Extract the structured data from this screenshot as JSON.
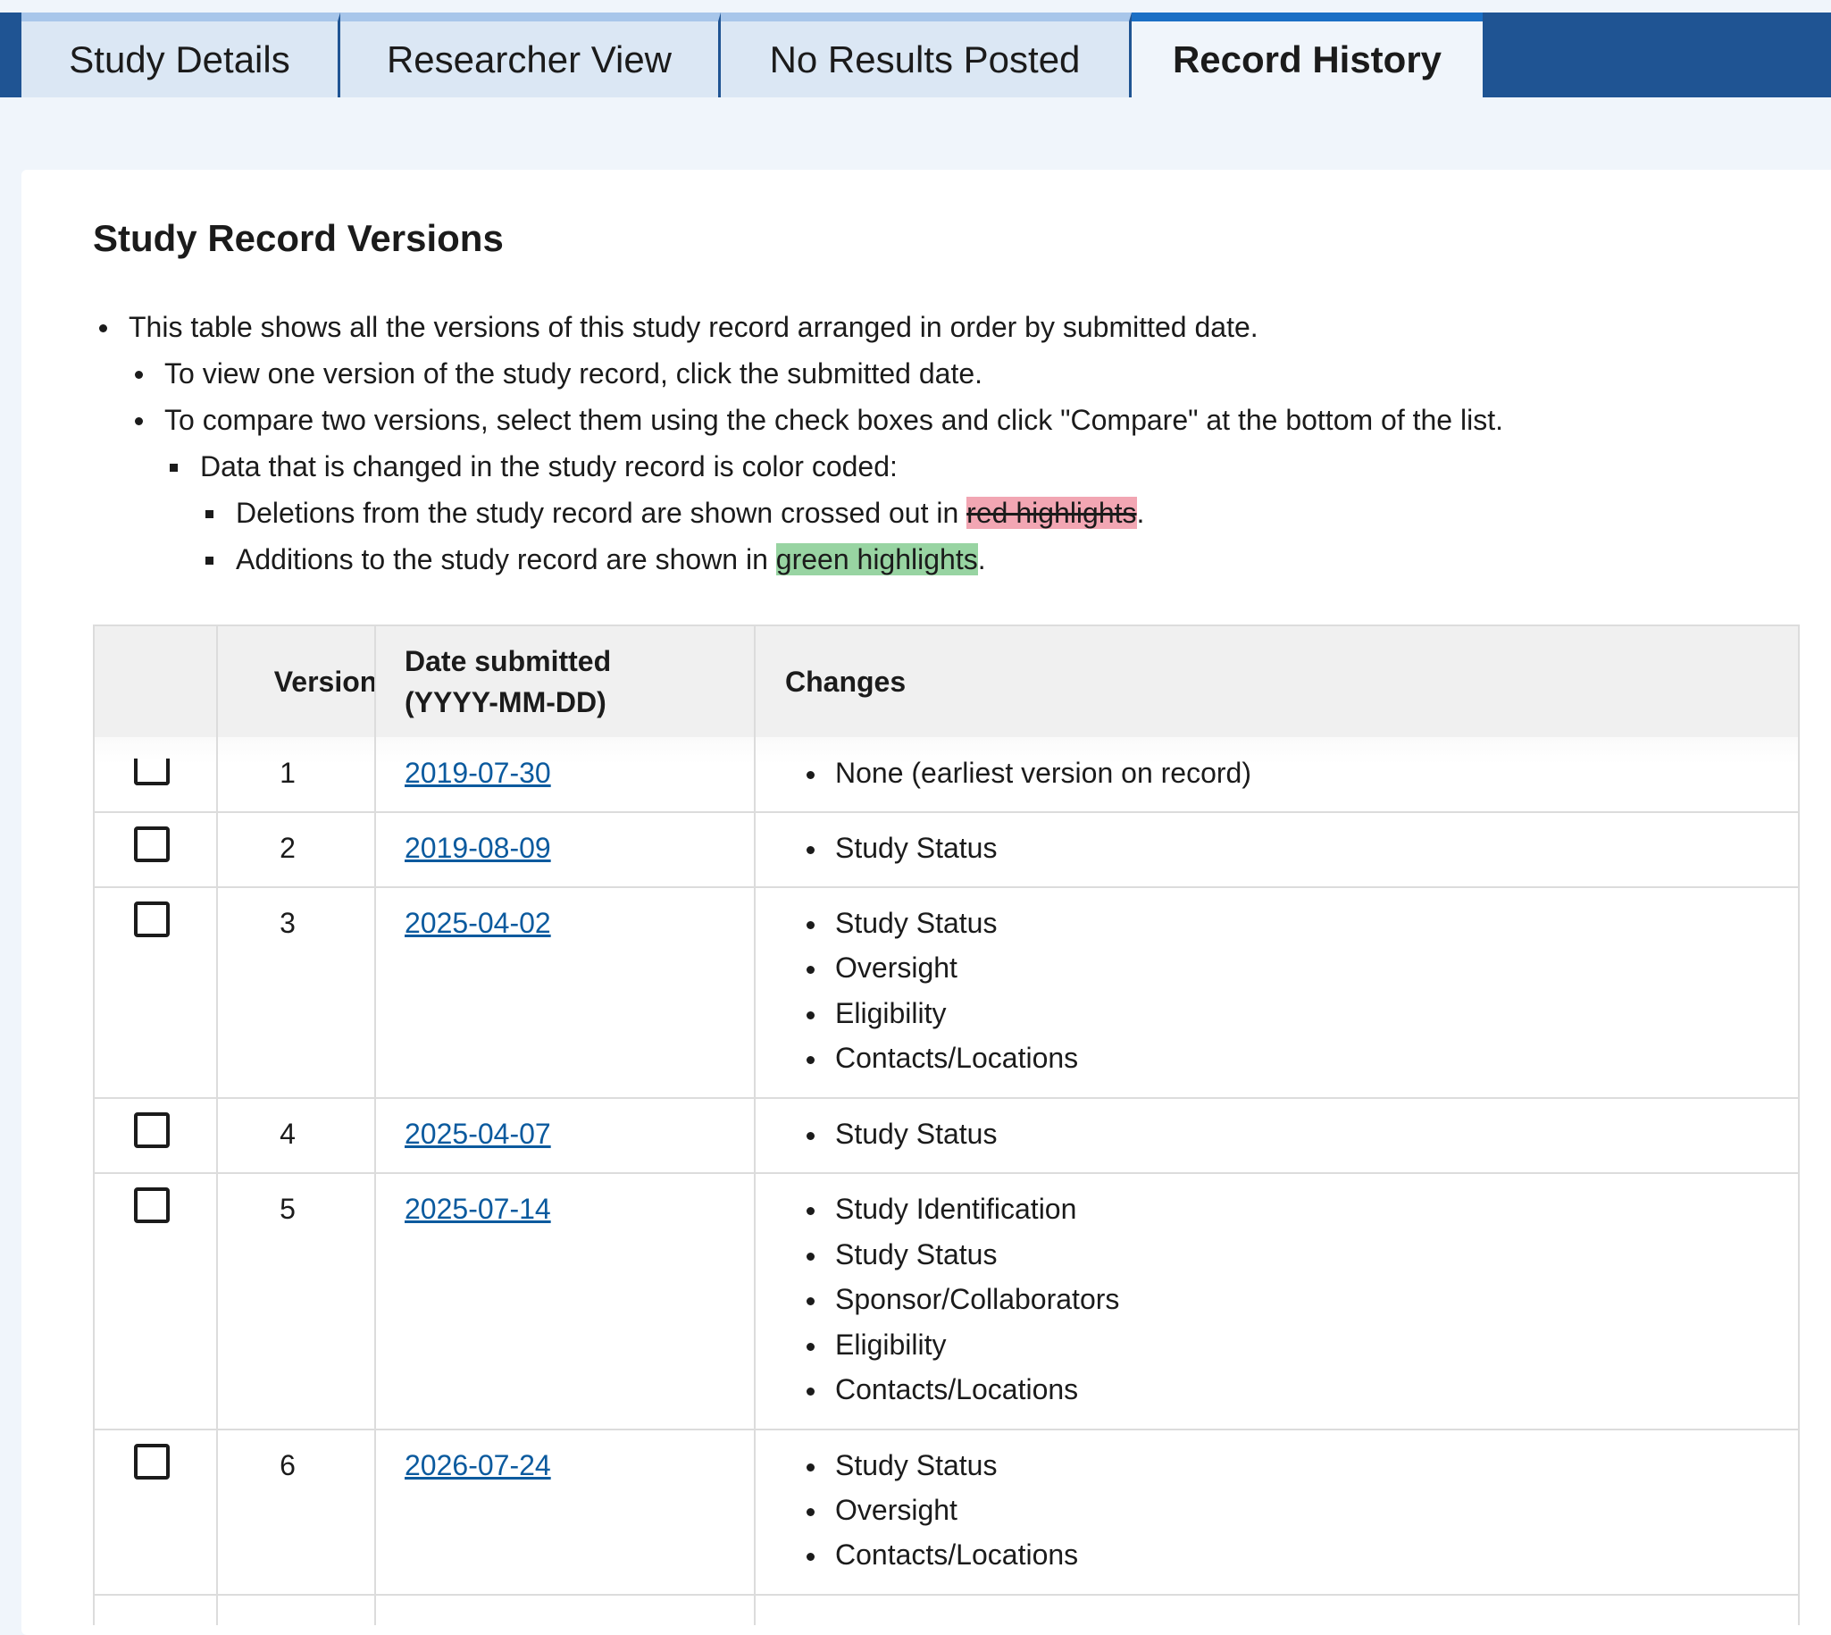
{
  "tabs": [
    {
      "label": "Study Details"
    },
    {
      "label": "Researcher View"
    },
    {
      "label": "No Results Posted"
    },
    {
      "label": "Record History"
    }
  ],
  "active_tab": "Record History",
  "section_title": "Study Record Versions",
  "intro": {
    "line1": "This table shows all the versions of this study record arranged in order by submitted date.",
    "line2": "To view one version of the study record, click the submitted date.",
    "line3": "To compare two versions, select them using the check boxes and click \"Compare\" at the bottom of the list.",
    "line4": "Data that is changed in the study record is color coded:",
    "line5_prefix": "Deletions from the study record are shown crossed out in ",
    "line5_highlight": "red highlights",
    "line5_suffix": ".",
    "line6_prefix": "Additions to the study record are shown in ",
    "line6_highlight": "green highlights",
    "line6_suffix": "."
  },
  "colors": {
    "tab_bar": "#1f5493",
    "link": "#0b5a9e",
    "deletion_highlight": "#f2a6b3",
    "addition_highlight": "#98d4a2"
  },
  "table": {
    "headers": {
      "version": "Version",
      "date_line1": "Date submitted",
      "date_line2": "(YYYY-MM-DD)",
      "changes": "Changes"
    },
    "rows": [
      {
        "version": "1",
        "date": "2019-07-30",
        "changes": [
          "None (earliest version on record)"
        ]
      },
      {
        "version": "2",
        "date": "2019-08-09",
        "changes": [
          "Study Status"
        ]
      },
      {
        "version": "3",
        "date": "2025-04-02",
        "changes": [
          "Study Status",
          "Oversight",
          "Eligibility",
          "Contacts/Locations"
        ]
      },
      {
        "version": "4",
        "date": "2025-04-07",
        "changes": [
          "Study Status"
        ]
      },
      {
        "version": "5",
        "date": "2025-07-14",
        "changes": [
          "Study Identification",
          "Study Status",
          "Sponsor/Collaborators",
          "Eligibility",
          "Contacts/Locations"
        ]
      },
      {
        "version": "6",
        "date": "2026-07-24",
        "changes": [
          "Study Status",
          "Oversight",
          "Contacts/Locations"
        ]
      }
    ]
  }
}
